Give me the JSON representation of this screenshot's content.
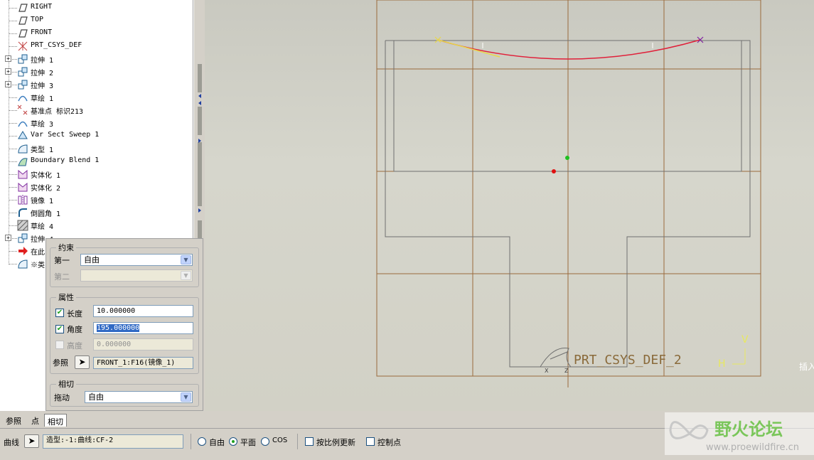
{
  "model_tree": {
    "items": [
      {
        "label": "RIGHT",
        "icon": "datum-plane-icon",
        "expand": false
      },
      {
        "label": "TOP",
        "icon": "datum-plane-icon",
        "expand": false
      },
      {
        "label": "FRONT",
        "icon": "datum-plane-icon",
        "expand": false
      },
      {
        "label": "PRT_CSYS_DEF",
        "icon": "csys-icon",
        "expand": false
      },
      {
        "label": "拉伸 1",
        "icon": "extrude-icon",
        "expand": true
      },
      {
        "label": "拉伸 2",
        "icon": "extrude-icon",
        "expand": true
      },
      {
        "label": "拉伸 3",
        "icon": "extrude-icon",
        "expand": true
      },
      {
        "label": "草绘 1",
        "icon": "sketch-icon",
        "expand": false
      },
      {
        "label": "基准点 标识213",
        "icon": "datum-point-icon",
        "expand": false
      },
      {
        "label": "草绘 3",
        "icon": "sketch-icon",
        "expand": false
      },
      {
        "label": "Var Sect Sweep 1",
        "icon": "sweep-icon",
        "expand": false
      },
      {
        "label": "类型 1",
        "icon": "style-icon",
        "expand": false
      },
      {
        "label": "Boundary Blend 1",
        "icon": "boundary-blend-icon",
        "expand": false
      },
      {
        "label": "实体化 1",
        "icon": "solidify-icon",
        "expand": false
      },
      {
        "label": "实体化 2",
        "icon": "solidify-icon",
        "expand": false
      },
      {
        "label": "镜像 1",
        "icon": "mirror-icon",
        "expand": false
      },
      {
        "label": "倒圆角 1",
        "icon": "round-icon",
        "expand": false
      },
      {
        "label": "草绘 4",
        "icon": "sketch-hatch-icon",
        "expand": false
      },
      {
        "label": "拉伸 4",
        "icon": "extrude-icon",
        "expand": true
      },
      {
        "label": "在此",
        "icon": "insert-here-arrow-icon",
        "expand": false
      },
      {
        "label": "※类",
        "icon": "style-icon",
        "expand": false
      }
    ]
  },
  "panel": {
    "constraint_legend": "约束",
    "first_label": "第一",
    "first_value": "自由",
    "second_label": "第二",
    "second_value": "",
    "props_legend": "属性",
    "length_label": "长度",
    "length_value": "10.000000",
    "angle_label": "角度",
    "angle_value": "195.000000",
    "height_label": "高度",
    "height_value": "0.000000",
    "ref_label": "参照",
    "ref_value": "FRONT_1:F16(镜像_1)",
    "tangent_legend": "相切",
    "drag_label": "拖动",
    "drag_value": "自由"
  },
  "bottom": {
    "tabs": [
      "参照",
      "点",
      "相切"
    ],
    "curve_label": "曲线",
    "curve_value": "造型:-1:曲线:CF-2",
    "radio_free": "自由",
    "radio_plane": "平面",
    "radio_cos": "COS",
    "chk_scale": "按比例更新",
    "chk_control": "控制点"
  },
  "viewport": {
    "csys_label": "PRT_CSYS_DEF_2",
    "axis_v": "V",
    "axis_h": "H",
    "edge_text": "插入"
  },
  "watermark": {
    "title": "野火论坛",
    "url": "www.proewildfire.cn"
  }
}
